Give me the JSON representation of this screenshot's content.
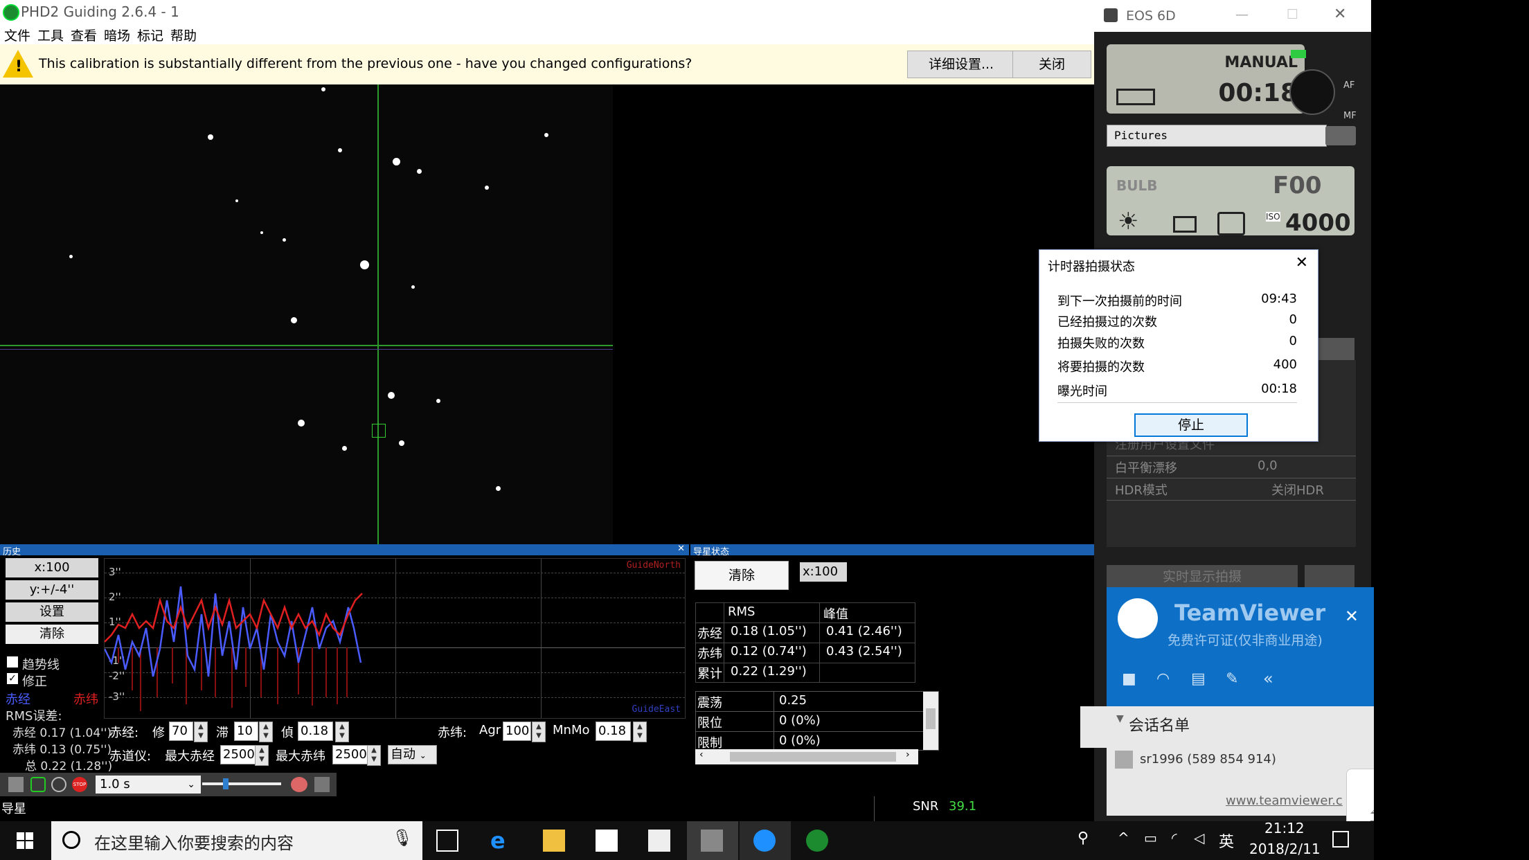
{
  "phd": {
    "title": "PHD2 Guiding 2.6.4 - 1",
    "menu": [
      "文件",
      "工具",
      "查看",
      "暗场",
      "标记",
      "帮助"
    ],
    "info_message": "This calibration is substantially different from the previous one - have you changed configurations?",
    "info_details_button": "详细设置...",
    "info_close_button": "关闭",
    "history_title": "历史",
    "guide_status_title": "导星状态",
    "history": {
      "x_scale": "x:100",
      "y_scale": "y:+/-4''",
      "settings": "设置",
      "clear": "清除",
      "trend_label": "趋势线",
      "correction_label": "修正",
      "ra_label": "赤经",
      "dec_label": "赤纬",
      "rms_error_label": "RMS误差:",
      "rms_ra": "赤经 0.17 (1.04'')",
      "rms_dec": "赤纬 0.13 (0.75'')",
      "rms_total": "总 0.22 (1.28'')",
      "y_ticks": [
        "3''",
        "2''",
        "1''",
        "-1''",
        "-2''",
        "-3''"
      ],
      "guide_north": "GuideNorth",
      "guide_east": "GuideEast",
      "trend_checked": false,
      "correction_checked": true
    },
    "params": {
      "ra_label": "赤经:",
      "ra_agg_label": "修",
      "ra_agg": "70",
      "ra_hys_label": "滞",
      "ra_hys": "10",
      "ra_min_label": "偵",
      "ra_min": "0.18",
      "dec_label": "赤纬:",
      "dec_agr_label": "Agr",
      "dec_agr": "100",
      "dec_minmo_label": "MnMo",
      "dec_minmo": "0.18",
      "mount_label": "赤道仪:",
      "max_ra_label": "最大赤经",
      "max_ra": "2500",
      "max_dec_label": "最大赤纬",
      "max_dec": "2500",
      "mode": "自动"
    },
    "guide_stats": {
      "clear": "清除",
      "x_scale": "x:100",
      "col_rms": "RMS",
      "col_peak": "峰值",
      "rows": [
        {
          "name": "赤经",
          "rms": "0.18 (1.05'')",
          "peak": "0.41 (2.46'')"
        },
        {
          "name": "赤纬",
          "rms": "0.12 (0.74'')",
          "peak": "0.43 (2.54'')"
        },
        {
          "name": "累计",
          "rms": "0.22 (1.29'')",
          "peak": ""
        }
      ],
      "osc_rows": [
        {
          "name": "震荡",
          "value": "0.25"
        },
        {
          "name": "限位",
          "value": "0 (0%)"
        },
        {
          "name": "限制",
          "value": "0 (0%)"
        }
      ]
    },
    "exposure": "1.0 s",
    "status_text": "导星",
    "snr_label": "SNR",
    "snr_value": "39.1"
  },
  "eos": {
    "title": "EOS 6D",
    "mode": "MANUAL",
    "timer": "00:18",
    "af_label": "AF",
    "mf_label": "MF",
    "folder": "Pictures",
    "bulb": "BULB",
    "aperture": "F00",
    "iso_label": "ISO",
    "iso": "4000",
    "wb_shift_label": "白平衡漂移",
    "wb_shift_value": "0,0",
    "hdr_label": "HDR模式",
    "hdr_value": "关闭HDR",
    "register_label": "注册用户设置文件",
    "live_view": "实时显示拍摄"
  },
  "timer_dialog": {
    "title": "计时器拍摄状态",
    "rows": [
      {
        "label": "到下一次拍摄前的时间",
        "value": "09:43"
      },
      {
        "label": "已经拍摄过的次数",
        "value": "0"
      },
      {
        "label": "拍摄失败的次数",
        "value": "0"
      },
      {
        "label": "将要拍摄的次数",
        "value": "400"
      },
      {
        "label": "曝光时间",
        "value": "00:18"
      }
    ],
    "stop": "停止"
  },
  "teamviewer": {
    "brand": "TeamViewer",
    "license": "免费许可证(仅非商业用途)",
    "session_list": "会话名单",
    "session_entry": "sr1996 (589 854 914)",
    "link": "www.teamviewer.c"
  },
  "taskbar": {
    "search_placeholder": "在这里输入你要搜索的内容",
    "time": "21:12",
    "date": "2018/2/11",
    "ime": "英"
  },
  "colors": {
    "ra_series": "#4a5cff",
    "dec_series": "#e02020",
    "guide_line": "#2c9a2c",
    "panel_header": "#1a5fb0",
    "teamviewer_blue": "#0e6fc7",
    "snr_value": "#44dd44"
  }
}
